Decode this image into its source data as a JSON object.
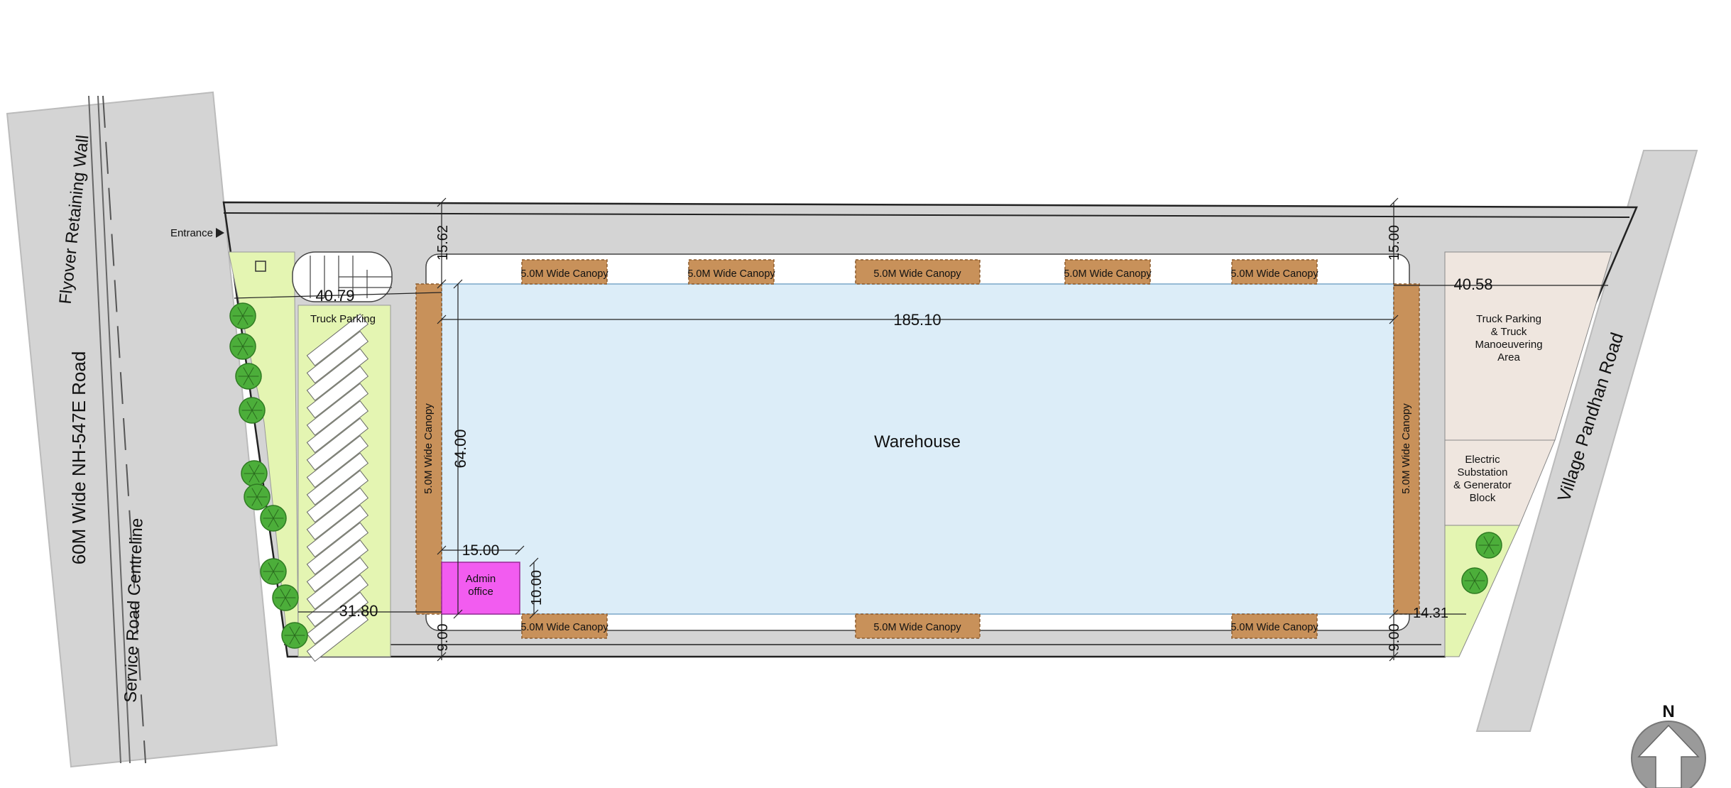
{
  "roads": {
    "highway": "60M Wide NH-547E Road",
    "retaining_wall": "Flyover Retaining Wall",
    "service_centreline": "Service Road Centreline",
    "village_road": "Village Pandhan Road"
  },
  "entrance": "Entrance",
  "zones": {
    "warehouse": "Warehouse",
    "admin_line1": "Admin",
    "admin_line2": "office",
    "truck_parking_left": "Truck Parking",
    "truck_parking_right": [
      "Truck Parking",
      "& Truck",
      "Manoeuvering",
      "Area"
    ],
    "substation": [
      "Electric",
      "Substation",
      "& Generator",
      "Block"
    ]
  },
  "canopy_label": "5.0M Wide Canopy",
  "dimensions": {
    "warehouse_length": "185.10",
    "warehouse_width": "64.00",
    "front_setback_left": "15.62",
    "front_setback_right": "15.00",
    "rear_setback_left": "9.00",
    "rear_setback_right": "9.00",
    "west_gap_top": "40.79",
    "west_gap_bottom": "31.80",
    "east_gap_top": "40.58",
    "east_gap_bottom": "14.31",
    "admin_width": "15.00",
    "admin_depth": "10.00"
  },
  "north": "N",
  "colors": {
    "road": "#d4d4d4",
    "warehouse": "#dcedf8",
    "canopy": "#c8915a",
    "admin": "#f25cf0",
    "landscape": "#e4f5b2",
    "tree": "#4cae3a",
    "parking_zone": "#efe6df"
  }
}
